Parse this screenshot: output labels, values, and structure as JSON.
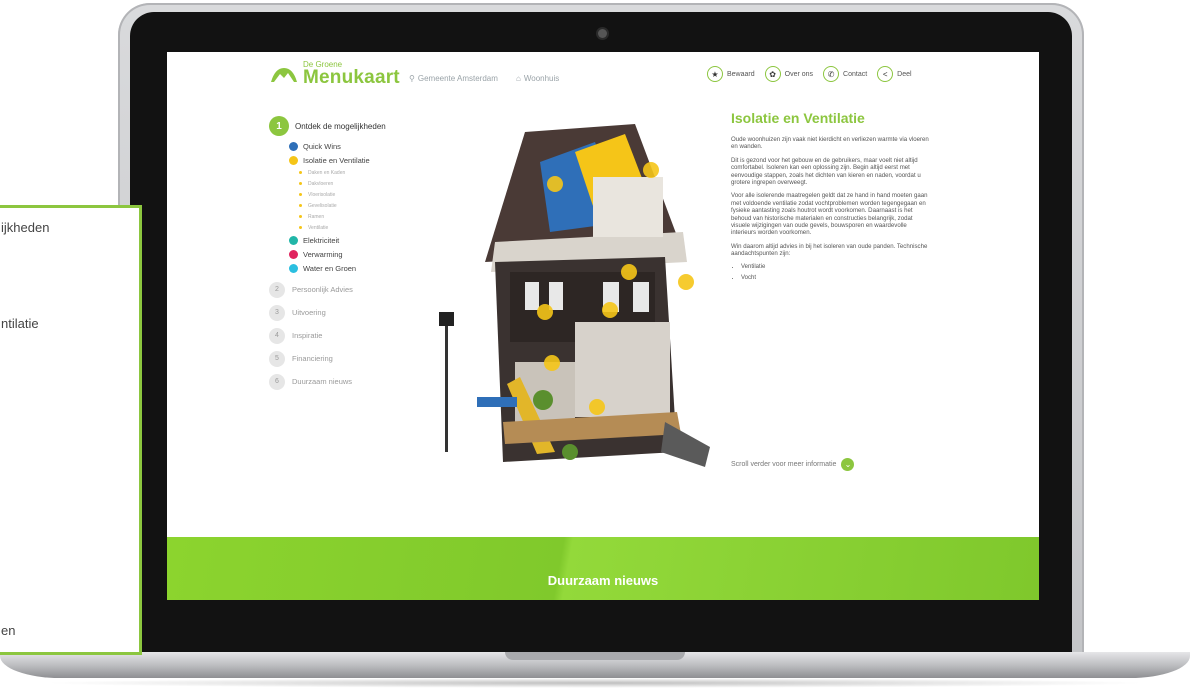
{
  "logo": {
    "small": "De Groene",
    "big": "Menukaart"
  },
  "crumbs": [
    {
      "icon": "location-pin-icon",
      "label": "Gemeente Amsterdam"
    },
    {
      "icon": "home-icon",
      "label": "Woonhuis"
    }
  ],
  "topnav": [
    {
      "icon": "star-icon",
      "label": "Bewaard"
    },
    {
      "icon": "info-icon",
      "label": "Over ons"
    },
    {
      "icon": "phone-icon",
      "label": "Contact"
    },
    {
      "icon": "share-icon",
      "label": "Deel"
    }
  ],
  "sidebar": {
    "head_num": "1",
    "head": "Ontdek de mogelijkheden",
    "sub": [
      {
        "label": "Quick Wins",
        "color": "#2f6fb8"
      },
      {
        "label": "Isolatie en Ventilatie",
        "color": "#f5c518"
      }
    ],
    "mini": [
      "Daken en Kaden",
      "Dakvloeren",
      "Vloerisolatie",
      "Gevelisolatie",
      "Ramen",
      "Ventilatie"
    ],
    "sub2": [
      {
        "label": "Elektriciteit",
        "color": "#21b6a8"
      },
      {
        "label": "Verwarming",
        "color": "#e0245e"
      },
      {
        "label": "Water en Groen",
        "color": "#2bbfe0"
      }
    ],
    "main": [
      {
        "num": "2",
        "label": "Persoonlijk Advies"
      },
      {
        "num": "3",
        "label": "Uitvoering"
      },
      {
        "num": "4",
        "label": "Inspiratie"
      },
      {
        "num": "5",
        "label": "Financiering"
      },
      {
        "num": "6",
        "label": "Duurzaam nieuws"
      }
    ]
  },
  "article": {
    "title": "Isolatie en Ventilatie",
    "p1": "Oude woonhuizen zijn vaak niet kierdicht en verliezen warmte via vloeren en wanden.",
    "p2": "Dit is gezond voor het gebouw en de gebruikers, maar voelt niet altijd comfortabel. Isoleren kan een oplossing zijn. Begin altijd eerst met eenvoudige stappen, zoals het dichten van kieren en naden, voordat u grotere ingrepen overweegt.",
    "p3": "Voor alle isolerende maatregelen geldt dat ze hand in hand moeten gaan met voldoende ventilatie zodat vochtproblemen worden tegengegaan en fysieke aantasting zoals houtrot wordt voorkomen. Daarnaast is het behoud van historische materialen en constructies belangrijk, zodat visuele wijzigingen van oude gevels, bouwsporen en waardevolle interieurs worden voorkomen.",
    "p4": "Win daarom altijd advies in bij het isoleren van oude panden. Technische aandachtspunten zijn:",
    "bullets": [
      "Ventilatie",
      "Vocht"
    ]
  },
  "scroll_label": "Scroll verder voor meer informatie",
  "banner_title": "Duurzaam nieuws",
  "overlay": {
    "line1": "ijkheden",
    "line2": "ntilatie",
    "line3": "en"
  }
}
